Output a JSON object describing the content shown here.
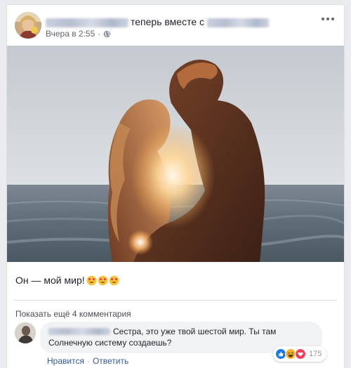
{
  "post": {
    "action_text": "теперь вместе с",
    "timestamp": "Вчера в 2:55",
    "separator": "·",
    "visibility_icon": "globe-icon",
    "menu_icon": "more-dots-icon",
    "caption": "Он — мой мир!",
    "caption_emoji": [
      "smiling-face-with-heart-eyes",
      "smiling-face-with-heart-eyes",
      "smiling-face-with-heart-eyes"
    ]
  },
  "comments": {
    "show_more_label": "Показать ещё 4 комментария",
    "items": [
      {
        "text": "Сестра, это уже твой шестой мир. Ты там Солнечную систему создаешь?",
        "like_label": "Нравится",
        "separator": "·",
        "reply_label": "Ответить",
        "reaction_icons": [
          "like-reaction-icon",
          "haha-reaction-icon",
          "love-reaction-icon"
        ],
        "reaction_count": "175"
      }
    ]
  },
  "colors": {
    "link": "#385898",
    "secondary_text": "#616770",
    "bubble": "#f2f3f5",
    "like_blue": "#1877f2",
    "love_red": "#f33e58",
    "haha_yellow": "#f7b125"
  }
}
